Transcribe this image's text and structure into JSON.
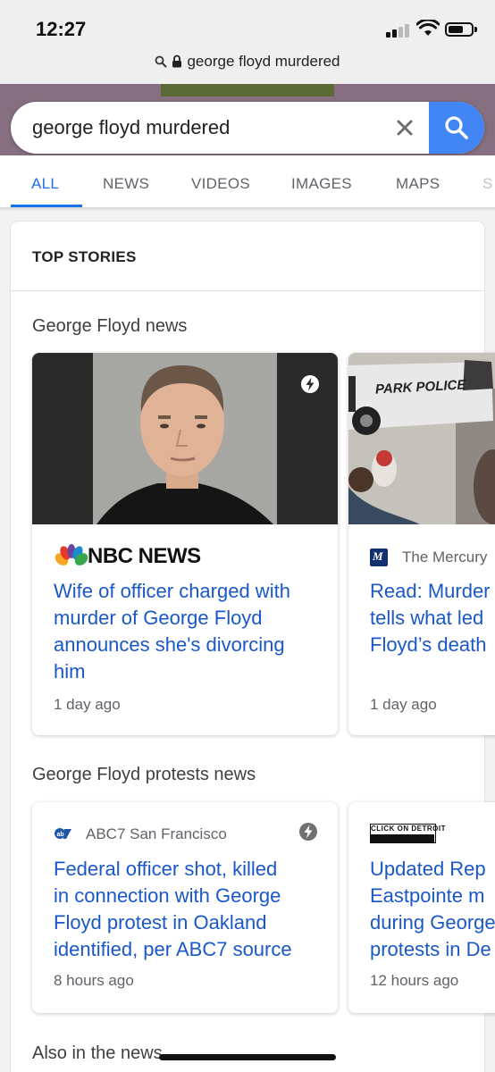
{
  "status": {
    "time": "12:27"
  },
  "browser": {
    "url": "george floyd murdered"
  },
  "search": {
    "query": "george floyd murdered"
  },
  "tabs": [
    "ALL",
    "NEWS",
    "VIDEOS",
    "IMAGES",
    "MAPS",
    "S"
  ],
  "top_stories": {
    "heading": "TOP STORIES"
  },
  "sections": [
    {
      "title": "George Floyd news",
      "cards": [
        {
          "source": "NBC NEWS",
          "headline_lines": [
            "Wife of officer charged with",
            "murder of George Floyd",
            "announces she's divorcing",
            "him"
          ],
          "age": "1 day ago"
        },
        {
          "source": "The Mercury",
          "headline_lines": [
            "Read: Murder",
            "tells what led",
            "Floyd’s death"
          ],
          "age": "1 day ago",
          "image_text": "PARK POLICE"
        }
      ]
    },
    {
      "title": "George Floyd protests news",
      "cards": [
        {
          "source": "ABC7 San Francisco",
          "headline_lines": [
            "Federal officer shot, killed",
            "in connection with George",
            "Floyd protest in Oakland",
            "identified, per ABC7 source"
          ],
          "age": "8 hours ago"
        },
        {
          "source": "CLICK ON DETROIT",
          "headline_lines": [
            "Updated Rep",
            "Eastpointe m",
            "during George",
            "protests in De"
          ],
          "age": "12 hours ago"
        }
      ]
    },
    {
      "title": "Also in the news"
    }
  ],
  "colors": {
    "link": "#1a57c8",
    "accent": "#1a73e8",
    "search_button": "#4285f4"
  }
}
